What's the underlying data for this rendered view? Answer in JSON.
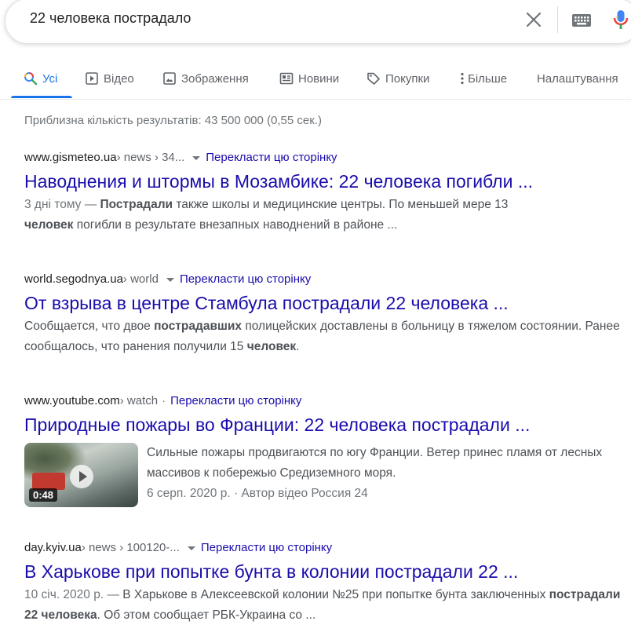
{
  "search": {
    "query": "22 человека пострадало"
  },
  "tabs": [
    {
      "label": "Усі"
    },
    {
      "label": "Відео"
    },
    {
      "label": "Зображення"
    },
    {
      "label": "Новини"
    },
    {
      "label": "Покупки"
    },
    {
      "label": "Більше"
    },
    {
      "label": "Налаштування"
    }
  ],
  "stats": "Приблизна кількість результатів: 43 500 000 (0,55 сек.)",
  "translate_label": "Перекласти цю сторінку",
  "results": [
    {
      "domain": "www.gismeteo.ua",
      "path": " › news › 34...",
      "title": "Наводнения и штормы в Мозамбике: 22 человека погибли ...",
      "date": "3 дні тому — ",
      "s1": "Пострадали",
      "s2": " также школы и медицинские центры. По меньшей мере 13 ",
      "s3": "человек",
      "s4": " погибли в результате внезапных наводнений в районе ..."
    },
    {
      "domain": "world.segodnya.ua",
      "path": " › world",
      "title": "От взрыва в центре Стамбула пострадали 22 человека ...",
      "s1": "Сообщается, что двое ",
      "s2": "пострадавших",
      "s3": " полицейских доставлены в больницу в тяжелом состоянии. Ранее сообщалось, что ранения получили 15 ",
      "s4": "человек",
      "s5": "."
    },
    {
      "domain": "www.youtube.com",
      "path": " › watch",
      "title": "Природные пожары во Франции: 22 человека пострадали ...",
      "duration": "0:48",
      "description": "Сильные пожары продвигаются по югу Франции. Ветер принес пламя от лесных массивов к побережью Средиземного моря.",
      "meta": "6 серп. 2020 р. · Автор відео Россия 24"
    },
    {
      "domain": "day.kyiv.ua",
      "path": " › news › 100120-...",
      "title": "В Харькове при попытке бунта в колонии пострадали 22 ...",
      "date": "10 січ. 2020 р. — ",
      "s1": "В Харькове в Алексеевской колонии №25 при попытке бунта заключенных ",
      "s2": "пострадали 22 человека",
      "s3": ". Об этом сообщает РБК-Украина со ..."
    }
  ],
  "colors": {
    "link": "#1a0dab",
    "accent": "#1a73e8",
    "snippet": "#4d5156",
    "muted": "#70757a"
  },
  "icons": [
    "clear-icon",
    "keyboard-icon",
    "microphone-icon",
    "search-icon",
    "video-icon",
    "image-icon",
    "news-icon",
    "tag-icon",
    "more-dots-icon",
    "play-icon"
  ]
}
